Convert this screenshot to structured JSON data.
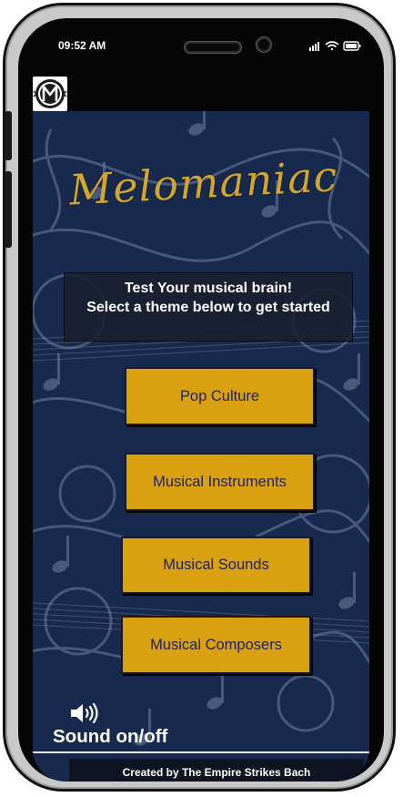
{
  "status_bar": {
    "time": "09:52 AM"
  },
  "app": {
    "logo_icon": "melomaniac-logo",
    "title": "Melomaniac"
  },
  "intro": {
    "line1": "Test Your musical brain!",
    "line2": "Select a theme below to get started"
  },
  "themes": [
    {
      "label": "Pop Culture"
    },
    {
      "label": "Musical Instruments"
    },
    {
      "label": "Musical Sounds"
    },
    {
      "label": "Musical Composers"
    }
  ],
  "sound": {
    "icon": "speaker-volume-icon",
    "label": "Sound on/off"
  },
  "footer": {
    "credit": "Created by The Empire Strikes Bach"
  },
  "colors": {
    "background": "#172a4d",
    "title_gold": "#d2a531",
    "button_gold": "#d9a10f",
    "button_text": "#1f1f66",
    "text": "#ffffff"
  }
}
